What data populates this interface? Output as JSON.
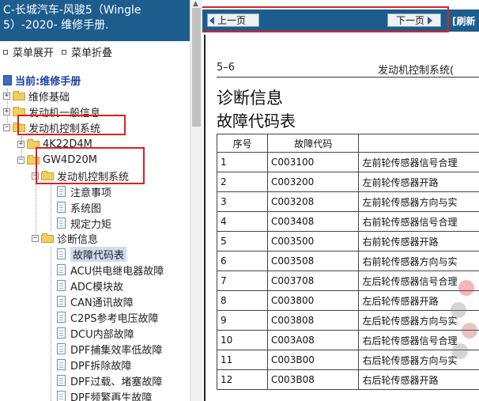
{
  "title": "C-长城汽车-风骏5（Wingle 5）-2020- 维修手册.",
  "menu_controls": {
    "expand": "菜单展开",
    "collapse": "菜单折叠"
  },
  "tree": {
    "current": "当前:维修手册",
    "items": [
      {
        "label": "维修基础"
      },
      {
        "label": "发动机一般信息"
      },
      {
        "label": "发动机控制系统"
      },
      {
        "label": "4K22D4M"
      },
      {
        "label": "GW4D20M"
      },
      {
        "label": "发动机控制系统"
      },
      {
        "label": "注意事项"
      },
      {
        "label": "系统图"
      },
      {
        "label": "规定力矩"
      },
      {
        "label": "诊断信息"
      },
      {
        "label": "故障代码表"
      },
      {
        "label": "ACU供电继电器故障"
      },
      {
        "label": "ADC模块故"
      },
      {
        "label": "CAN通讯故障"
      },
      {
        "label": "C2PS参考电压故障"
      },
      {
        "label": "DCU内部故障"
      },
      {
        "label": "DPF捕集效率低故障"
      },
      {
        "label": "DPF拆除故障"
      },
      {
        "label": "DPF过载、堵塞故障"
      },
      {
        "label": "DPF频繁再生故障"
      }
    ]
  },
  "nav": {
    "prev": "上一页",
    "next": "下一页",
    "refresh": "[刷新"
  },
  "doc": {
    "section": "5–6",
    "chapter": "发动机控制系统(",
    "heading1": "诊断信息",
    "heading2": "故障代码表",
    "table": {
      "headers": [
        "序号",
        "故障代码",
        ""
      ],
      "rows": [
        [
          "1",
          "C003100",
          "左前轮传感器信号合理"
        ],
        [
          "2",
          "C003200",
          "左前轮传感器开路"
        ],
        [
          "3",
          "C003208",
          "左前轮传感器方向与实"
        ],
        [
          "4",
          "C003408",
          "右前轮传感器信号合理"
        ],
        [
          "5",
          "C003500",
          "右前轮传感器开路"
        ],
        [
          "6",
          "C003508",
          "右前轮传感器方向与实"
        ],
        [
          "7",
          "C003708",
          "左后轮传感器信号合理"
        ],
        [
          "8",
          "C003800",
          "左后轮传感器开路"
        ],
        [
          "9",
          "C003808",
          "左后轮传感器方向与实"
        ],
        [
          "10",
          "C003A08",
          "右后轮传感器信号合理"
        ],
        [
          "11",
          "C003B00",
          "右后轮传感器方向与实"
        ],
        [
          "12",
          "C003B08",
          "右后轮传感器开路"
        ]
      ]
    }
  },
  "colors": {
    "header_blue": "#1d5d8e",
    "highlight_red": "#e02020",
    "selection": "#d0dcef"
  }
}
